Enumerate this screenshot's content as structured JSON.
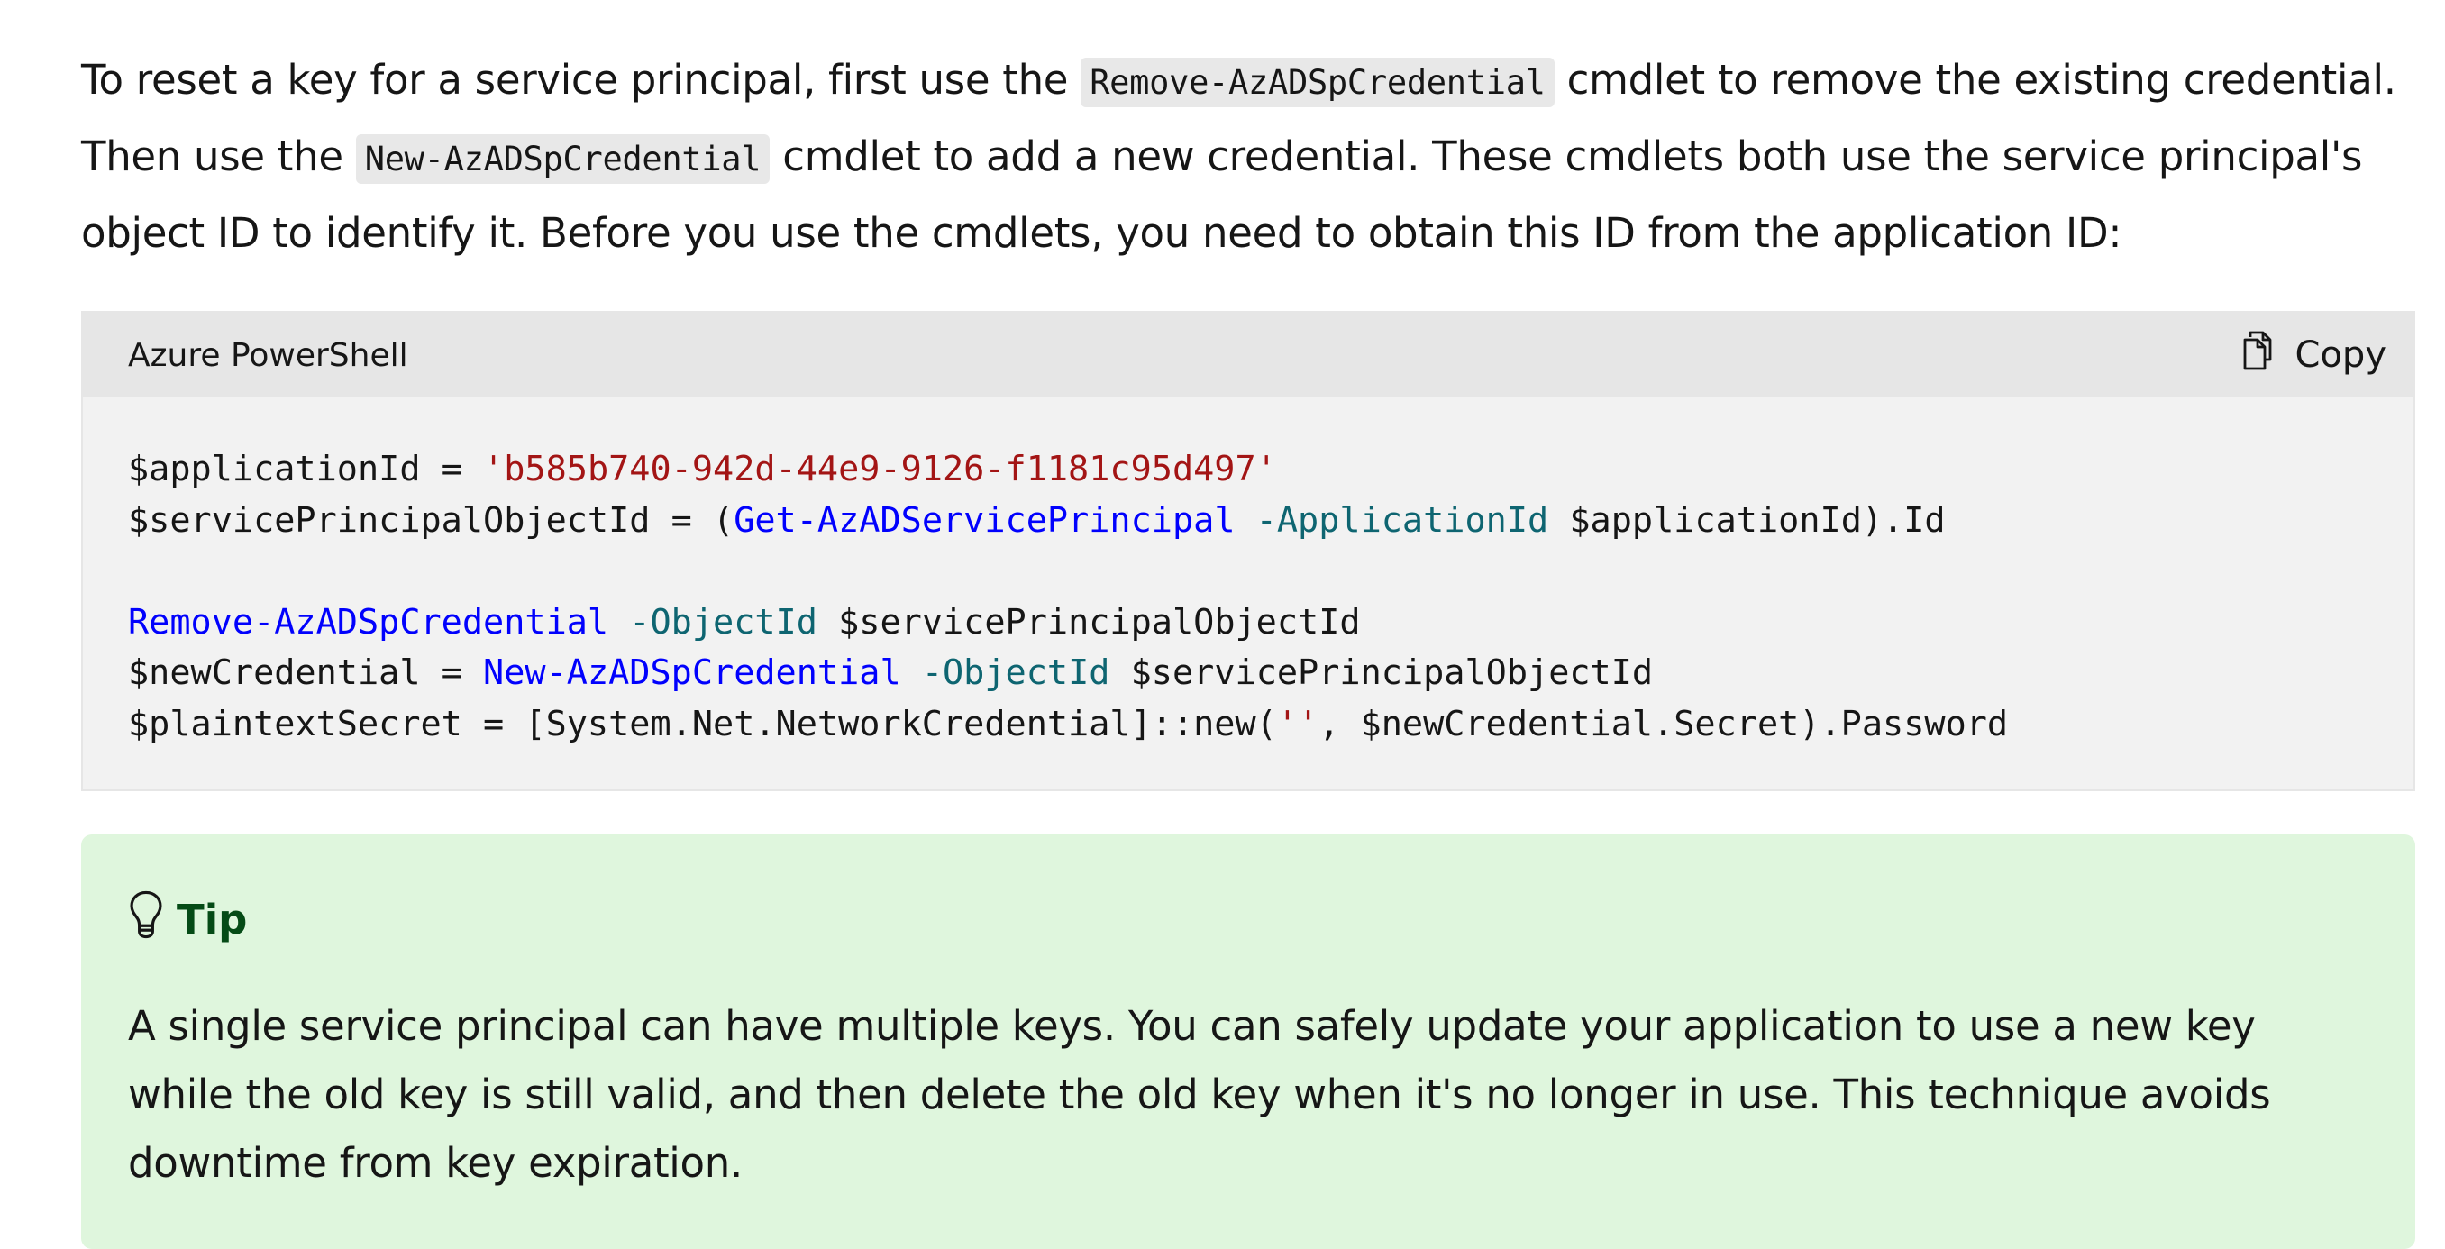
{
  "intro": {
    "part1": "To reset a key for a service principal, first use the ",
    "code1": "Remove-AzADSpCredential",
    "part2": " cmdlet to remove the existing credential. Then use the ",
    "code2": "New-AzADSpCredential",
    "part3": " cmdlet to add a new credential. These cmdlets both use the service principal's object ID to identify it. Before you use the cmdlets, you need to obtain this ID from the application ID:"
  },
  "code_block": {
    "language": "Azure PowerShell",
    "copy_label": "Copy",
    "copy_icon": "copy-icon",
    "line1": {
      "var": "$applicationId = ",
      "str": "'b585b740-942d-44e9-9126-f1181c95d497'"
    },
    "line2": {
      "a": "$servicePrincipalObjectId = (",
      "cmd": "Get-AzADServicePrincipal",
      "param": " -ApplicationId",
      "b": " $applicationId).Id"
    },
    "line3": {
      "cmd": "Remove-AzADSpCredential",
      "param": " -ObjectId",
      "b": " $servicePrincipalObjectId"
    },
    "line4": {
      "a": "$newCredential = ",
      "cmd": "New-AzADSpCredential",
      "param": " -ObjectId",
      "b": " $servicePrincipalObjectId"
    },
    "line5": {
      "a": "$plaintextSecret = [System.Net.NetworkCredential]::new(",
      "str": "''",
      "b": ", $newCredential.Secret).Password"
    }
  },
  "tip": {
    "icon": "lightbulb-icon",
    "title": "Tip",
    "text": "A single service principal can have multiple keys. You can safely update your application to use a new key while the old key is still valid, and then delete the old key when it's no longer in use. This technique avoids downtime from key expiration."
  },
  "colors": {
    "tip_background": "#dff6dd",
    "tip_title": "#054b16",
    "code_string": "#a31515",
    "code_cmdlet": "#0101fd",
    "code_parameter": "#0e6571"
  }
}
